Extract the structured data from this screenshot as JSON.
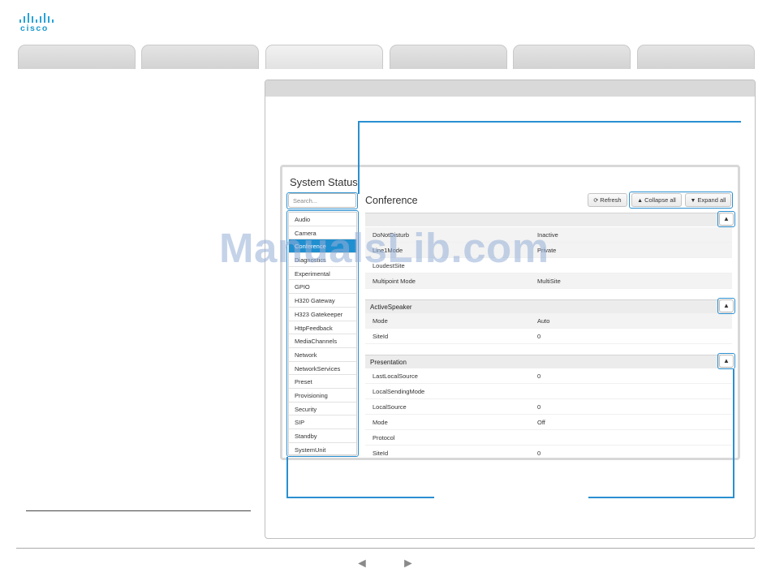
{
  "brand": {
    "logo_text": "cisco",
    "accent": "#1b9ad0"
  },
  "panel": {
    "title": "System Status",
    "search_placeholder": "Search..."
  },
  "nav_items": [
    "Audio",
    "Camera",
    "Conference",
    "Diagnostics",
    "Experimental",
    "GPIO",
    "H320 Gateway",
    "H323 Gatekeeper",
    "HttpFeedback",
    "MediaChannels",
    "Network",
    "NetworkServices",
    "Preset",
    "Provisioning",
    "Security",
    "SIP",
    "Standby",
    "SystemUnit"
  ],
  "active_nav": "Conference",
  "section": {
    "title": "Conference",
    "refresh_label": "Refresh",
    "collapse_label": "Collapse all",
    "expand_label": "Expand all"
  },
  "groups": {
    "top": {
      "rows": [
        {
          "key": "DoNotDisturb",
          "value": "Inactive"
        },
        {
          "key": "Line1Mode",
          "value": "Private"
        },
        {
          "key": "LoudestSite",
          "value": ""
        },
        {
          "key": "Multipoint Mode",
          "value": "MultiSite"
        }
      ]
    },
    "active_speaker": {
      "title": "ActiveSpeaker",
      "rows": [
        {
          "key": "Mode",
          "value": "Auto"
        },
        {
          "key": "SiteId",
          "value": "0"
        }
      ]
    },
    "presentation": {
      "title": "Presentation",
      "rows": [
        {
          "key": "LastLocalSource",
          "value": "0"
        },
        {
          "key": "LocalSendingMode",
          "value": ""
        },
        {
          "key": "LocalSource",
          "value": "0"
        },
        {
          "key": "Mode",
          "value": "Off"
        },
        {
          "key": "Protocol",
          "value": ""
        },
        {
          "key": "SiteId",
          "value": "0"
        }
      ]
    }
  },
  "watermark": "ManualsLib.com",
  "footer": {
    "prev_symbol": "◄",
    "next_symbol": "►"
  },
  "icons": {
    "refresh": "refresh-icon",
    "collapse": "chevron-up-icon",
    "expand": "chevron-down-icon"
  }
}
